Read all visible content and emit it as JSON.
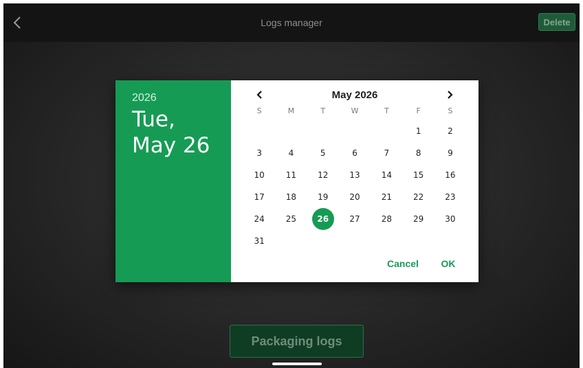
{
  "topbar": {
    "back_icon": "chevron-left-icon",
    "title": "Logs manager",
    "delete_label": "Delete"
  },
  "date_picker": {
    "header": {
      "year": "2026",
      "weekday_line": "Tue,",
      "date_line": "May 26"
    },
    "month_label": "May 2026",
    "prev_icon": "chevron-left-icon",
    "next_icon": "chevron-right-icon",
    "weekdays": [
      "S",
      "M",
      "T",
      "W",
      "T",
      "F",
      "S"
    ],
    "weeks": [
      [
        "",
        "",
        "",
        "",
        "",
        "1",
        "2"
      ],
      [
        "3",
        "4",
        "5",
        "6",
        "7",
        "8",
        "9"
      ],
      [
        "10",
        "11",
        "12",
        "13",
        "14",
        "15",
        "16"
      ],
      [
        "17",
        "18",
        "19",
        "20",
        "21",
        "22",
        "23"
      ],
      [
        "24",
        "25",
        "26",
        "27",
        "28",
        "29",
        "30"
      ],
      [
        "31",
        "",
        "",
        "",
        "",
        "",
        ""
      ]
    ],
    "selected_day": "26",
    "cancel_label": "Cancel",
    "ok_label": "OK"
  },
  "main": {
    "packaging_label": "Packaging logs"
  },
  "colors": {
    "accent": "#169b55",
    "topbar": "#141414",
    "background": "#2a2a2a"
  }
}
